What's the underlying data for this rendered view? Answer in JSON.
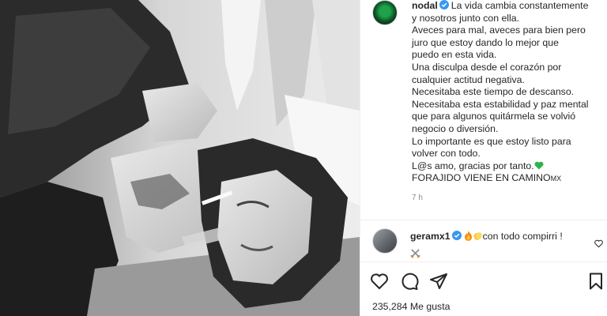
{
  "post": {
    "username": "nodal",
    "caption_lines": [
      "La vida cambia constantemente",
      "y nosotros junto con ella.",
      "Aveces para mal, aveces para bien pero",
      "juro que estoy dando lo mejor que",
      "puedo en esta vida.",
      "Una disculpa desde el corazón por",
      "cualquier actitud negativa.",
      "Necesitaba este tiempo de descanso.",
      "Necesitaba esta estabilidad y paz mental",
      "que para algunos quitármela se volvió",
      "negocio o diversión.",
      "Lo importante es que estoy listo para",
      "volver con todo.",
      "L@s amo, gracias por tanto.",
      "FORAJIDO VIENE EN CAMINO"
    ],
    "country_tag": "MX",
    "timestamp": "7 h",
    "likes": "235,284 Me gusta"
  },
  "comment": {
    "username": "geramx1",
    "text": "con todo compirri !"
  },
  "icons": {
    "verified": "verified-badge-icon",
    "green_heart": "green-heart-emoji",
    "like": "heart-icon",
    "comment": "comment-bubble-icon",
    "share": "paper-plane-icon",
    "save": "bookmark-icon",
    "comment_like": "small-heart-icon"
  },
  "colors": {
    "verified_blue": "#3897f0",
    "text": "#262626",
    "muted": "#8e8e8e",
    "green_heart": "#2fb24c"
  }
}
